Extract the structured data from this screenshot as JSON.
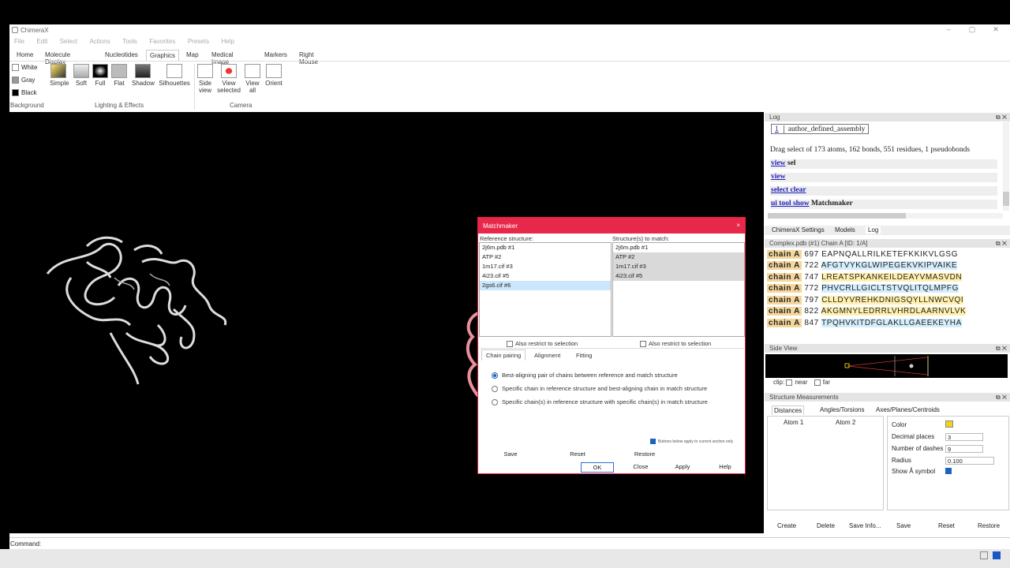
{
  "app": {
    "title": "ChimeraX"
  },
  "menubar": [
    "File",
    "Edit",
    "Select",
    "Actions",
    "Tools",
    "Favorites",
    "Presets",
    "Help"
  ],
  "tabs": [
    "Home",
    "Molecule Display",
    "Nucleotides",
    "Graphics",
    "Map",
    "Medical Image",
    "Markers",
    "Right Mouse"
  ],
  "active_tab": "Graphics",
  "ribbon": {
    "background": [
      "White",
      "Gray",
      "Black"
    ],
    "background_label": "Background",
    "lighting": [
      "Simple",
      "Soft",
      "Full",
      "Flat",
      "Shadow",
      "Silhouettes"
    ],
    "lighting_label": "Lighting & Effects",
    "camera": [
      [
        "Side",
        "view"
      ],
      [
        "View",
        "selected"
      ],
      [
        "View",
        "all"
      ],
      [
        "Orient",
        ""
      ]
    ],
    "camera_label": "Camera"
  },
  "matchmaker": {
    "title": "Matchmaker",
    "ref_label": "Reference structure:",
    "match_label": "Structure(s) to match:",
    "ref_items": [
      "2j6m.pdb #1",
      "ATP #2",
      "1m17.cif #3",
      "4i23.cif #5",
      "2gs6.cif #6"
    ],
    "ref_selected": 4,
    "match_items": [
      "2j6m.pdb #1",
      "ATP #2",
      "1m17.cif #3",
      "4i23.cif #5"
    ],
    "restrict_left": "Also restrict to selection",
    "restrict_right": "Also restrict to selection",
    "tabs": [
      "Chain pairing",
      "Alignment",
      "Fitting"
    ],
    "options": [
      "Best-aligning pair of chains between reference and match structure",
      "Specific chain in reference structure and best-aligning chain in match structure",
      "Specific chain(s) in reference structure with specific chain(s) in match structure"
    ],
    "selected_option": 0,
    "section_note": "Buttons below apply to current section only",
    "row1": [
      "Save",
      "Reset",
      "Restore"
    ],
    "row2": [
      "OK",
      "Close",
      "Apply",
      "Help"
    ]
  },
  "log": {
    "title": "Log",
    "assembly_num": "1",
    "assembly": "author_defined_assembly",
    "drag": "Drag select of 173 atoms, 162 bonds, 551 residues, 1 pseudobonds",
    "cmds": [
      {
        "link": "view",
        "rest": " sel"
      },
      {
        "link": "view",
        "rest": ""
      },
      {
        "link": "select clear",
        "rest": ""
      },
      {
        "link": "ui tool show",
        "rest": " Matchmaker"
      }
    ],
    "tabs": [
      "ChimeraX Settings",
      "Models",
      "Log"
    ]
  },
  "sequence": {
    "title": "Complex.pdb (#1) Chain A [ID: 1/A]",
    "rows": [
      {
        "chain": "chain A",
        "num": "697",
        "seq": "EAPNQALLRILKETEFKKIKVLGSG"
      },
      {
        "chain": "chain A",
        "num": "722",
        "seq": "AFGTVYKGLWIPEGEKVKIPVAIKE"
      },
      {
        "chain": "chain A",
        "num": "747",
        "seq": "LREATSPKANKEILDEAYVMASVDN"
      },
      {
        "chain": "chain A",
        "num": "772",
        "seq": "PHVCRLLGICLTSTVQLITQLMPFG"
      },
      {
        "chain": "chain A",
        "num": "797",
        "seq": "CLLDYVREHKDNIGSQYLLNWCVQI"
      },
      {
        "chain": "chain A",
        "num": "822",
        "seq": "AKGMNYLEDRRLVHRDLAARNVLVK"
      },
      {
        "chain": "chain A",
        "num": "847",
        "seq": "TPQHVKITDFGLAKLLGAEEKEYHA"
      }
    ]
  },
  "sideview": {
    "title": "Side View",
    "clip": "clip:",
    "near": "near",
    "far": "far"
  },
  "measure": {
    "title": "Structure Measurements",
    "tabs": [
      "Distances",
      "Angles/Torsions",
      "Axes/Planes/Centroids"
    ],
    "cols": [
      "Atom 1",
      "Atom 2"
    ],
    "color_label": "Color",
    "color_value": "#f2d21a",
    "decimal_label": "Decimal places",
    "decimal_value": "3",
    "dashes_label": "Number of dashes",
    "dashes_value": "9",
    "radius_label": "Radius",
    "radius_value": "0.100",
    "show_label": "Show Å symbol",
    "buttons": [
      "Create",
      "Delete",
      "Save Info...",
      "Save",
      "Reset",
      "Restore"
    ]
  },
  "command": {
    "label": "Command:",
    "value": ""
  }
}
